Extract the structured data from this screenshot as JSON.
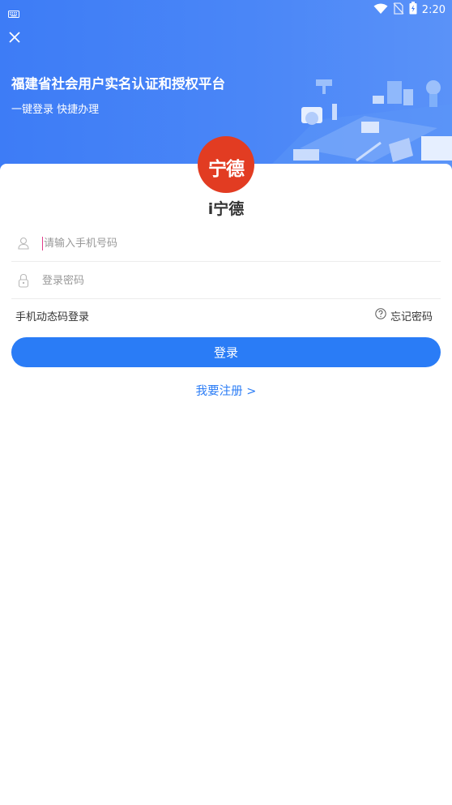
{
  "status_bar": {
    "time": "2:20"
  },
  "header": {
    "title": "福建省社会用户实名认证和授权平台",
    "subtitle": "一键登录 快捷办理"
  },
  "logo": {
    "text": "宁德"
  },
  "app_name": "i宁德",
  "form": {
    "phone_placeholder": "请输入手机号码",
    "password_placeholder": "登录密码"
  },
  "links": {
    "sms_login": "手机动态码登录",
    "forgot_password": "忘记密码"
  },
  "login_button": "登录",
  "register_link": "我要注册 >",
  "colors": {
    "header_blue": "#3d7cf6",
    "primary": "#2a7cf6",
    "logo_red": "#e23c22"
  }
}
